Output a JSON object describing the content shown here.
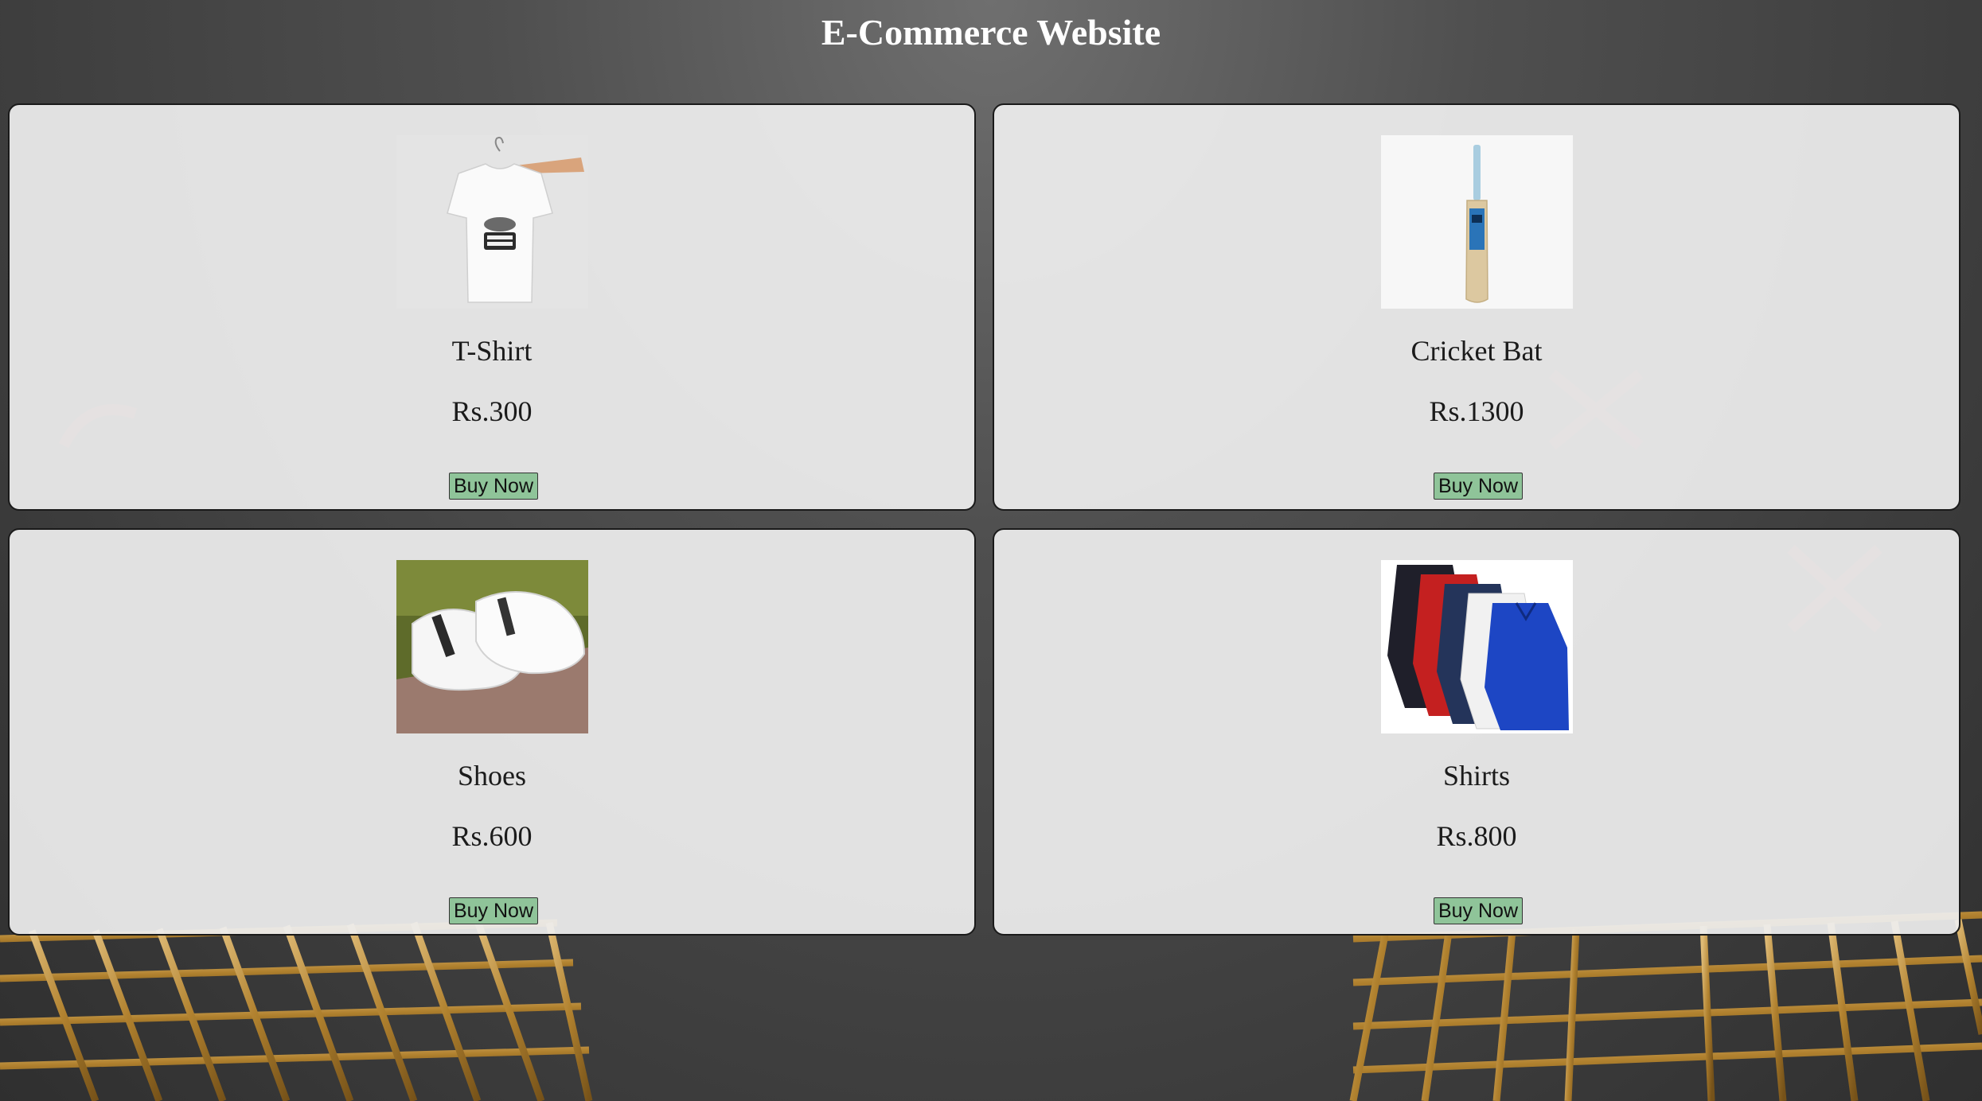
{
  "page": {
    "title": "E-Commerce Website"
  },
  "products": [
    {
      "name": "T-Shirt",
      "price": "Rs.300",
      "button_label": "Buy Now",
      "image": "t-shirt-photo"
    },
    {
      "name": "Cricket Bat",
      "price": "Rs.1300",
      "button_label": "Buy Now",
      "image": "cricket-bat-photo"
    },
    {
      "name": "Shoes",
      "price": "Rs.600",
      "button_label": "Buy Now",
      "image": "shoes-photo"
    },
    {
      "name": "Shirts",
      "price": "Rs.800",
      "button_label": "Buy Now",
      "image": "shirts-photo"
    }
  ],
  "colors": {
    "background": "#3a3a3a",
    "card": "#eeeeee",
    "button": "#8fc499",
    "title": "#ffffff",
    "cart_gold": "#c8963c"
  }
}
